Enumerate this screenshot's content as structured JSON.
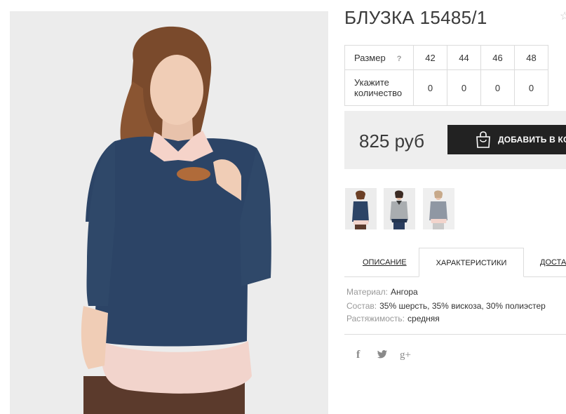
{
  "product": {
    "title": "БЛУЗКА 15485/1"
  },
  "sizes": {
    "header_label": "Размер",
    "help_icon": "?",
    "values": [
      "42",
      "44",
      "46",
      "48"
    ],
    "qty_label_line1": "Укажите",
    "qty_label_line2": "количество",
    "quantities": [
      "0",
      "0",
      "0",
      "0"
    ]
  },
  "price": {
    "text": "825 руб"
  },
  "buy_button": {
    "label": "ДОБАВИТЬ В КОРЗИНУ",
    "icon": "shopping-bag-icon"
  },
  "tabs": [
    {
      "label": "ОПИСАНИЕ",
      "active": false
    },
    {
      "label": "ХАРАКТЕРИСТИКИ",
      "active": true
    },
    {
      "label": "ДОСТАВКА",
      "active": false
    }
  ],
  "specs": [
    {
      "key": "Материал:",
      "value": "Ангора"
    },
    {
      "key": "Состав:",
      "value": "35% шерсть, 35% вискоза, 30% полиэстер"
    },
    {
      "key": "Растяжимость:",
      "value": "средняя"
    }
  ],
  "social": [
    {
      "glyph": "f",
      "icon": "facebook-icon"
    },
    {
      "glyph": "t",
      "icon": "twitter-icon"
    },
    {
      "glyph": "g+",
      "icon": "google-plus-icon"
    }
  ],
  "colors": {
    "blouse": "#2c4466",
    "collar": "#f5d3c9",
    "button": "#222222",
    "price_bg": "#eeeeee"
  }
}
